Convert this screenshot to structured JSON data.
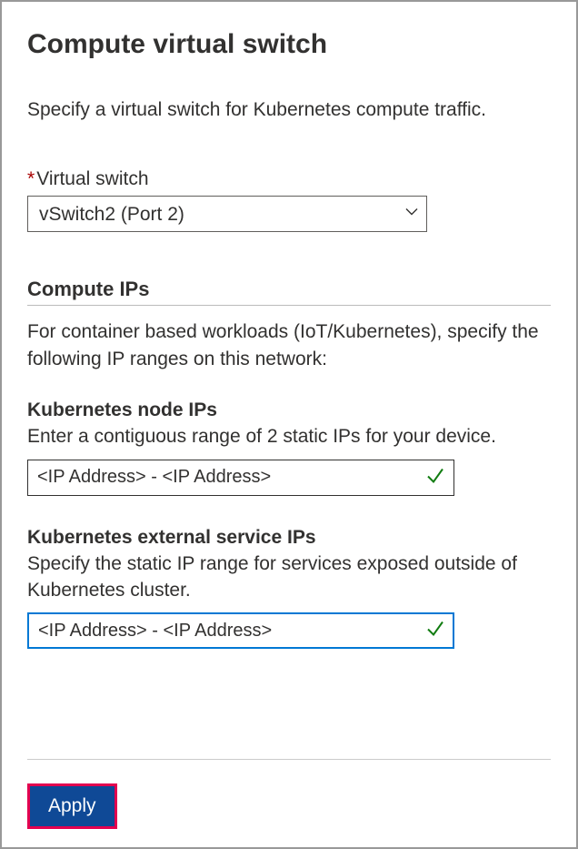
{
  "title": "Compute virtual switch",
  "subtitle": "Specify a virtual switch for Kubernetes compute traffic.",
  "virtualSwitch": {
    "label": "Virtual switch",
    "requiredMark": "*",
    "value": "vSwitch2 (Port 2)"
  },
  "computeIPs": {
    "heading": "Compute IPs",
    "description": "For container based workloads (IoT/Kubernetes), specify the following IP ranges on this network:"
  },
  "nodeIPs": {
    "label": "Kubernetes node IPs",
    "description": "Enter a contiguous range of 2 static IPs for your device.",
    "value": "<IP Address> - <IP Address>"
  },
  "serviceIPs": {
    "label": "Kubernetes external service IPs",
    "description": "Specify the static IP range for services exposed outside of Kubernetes cluster.",
    "value": "<IP Address> - <IP Address>"
  },
  "footer": {
    "applyLabel": "Apply"
  }
}
